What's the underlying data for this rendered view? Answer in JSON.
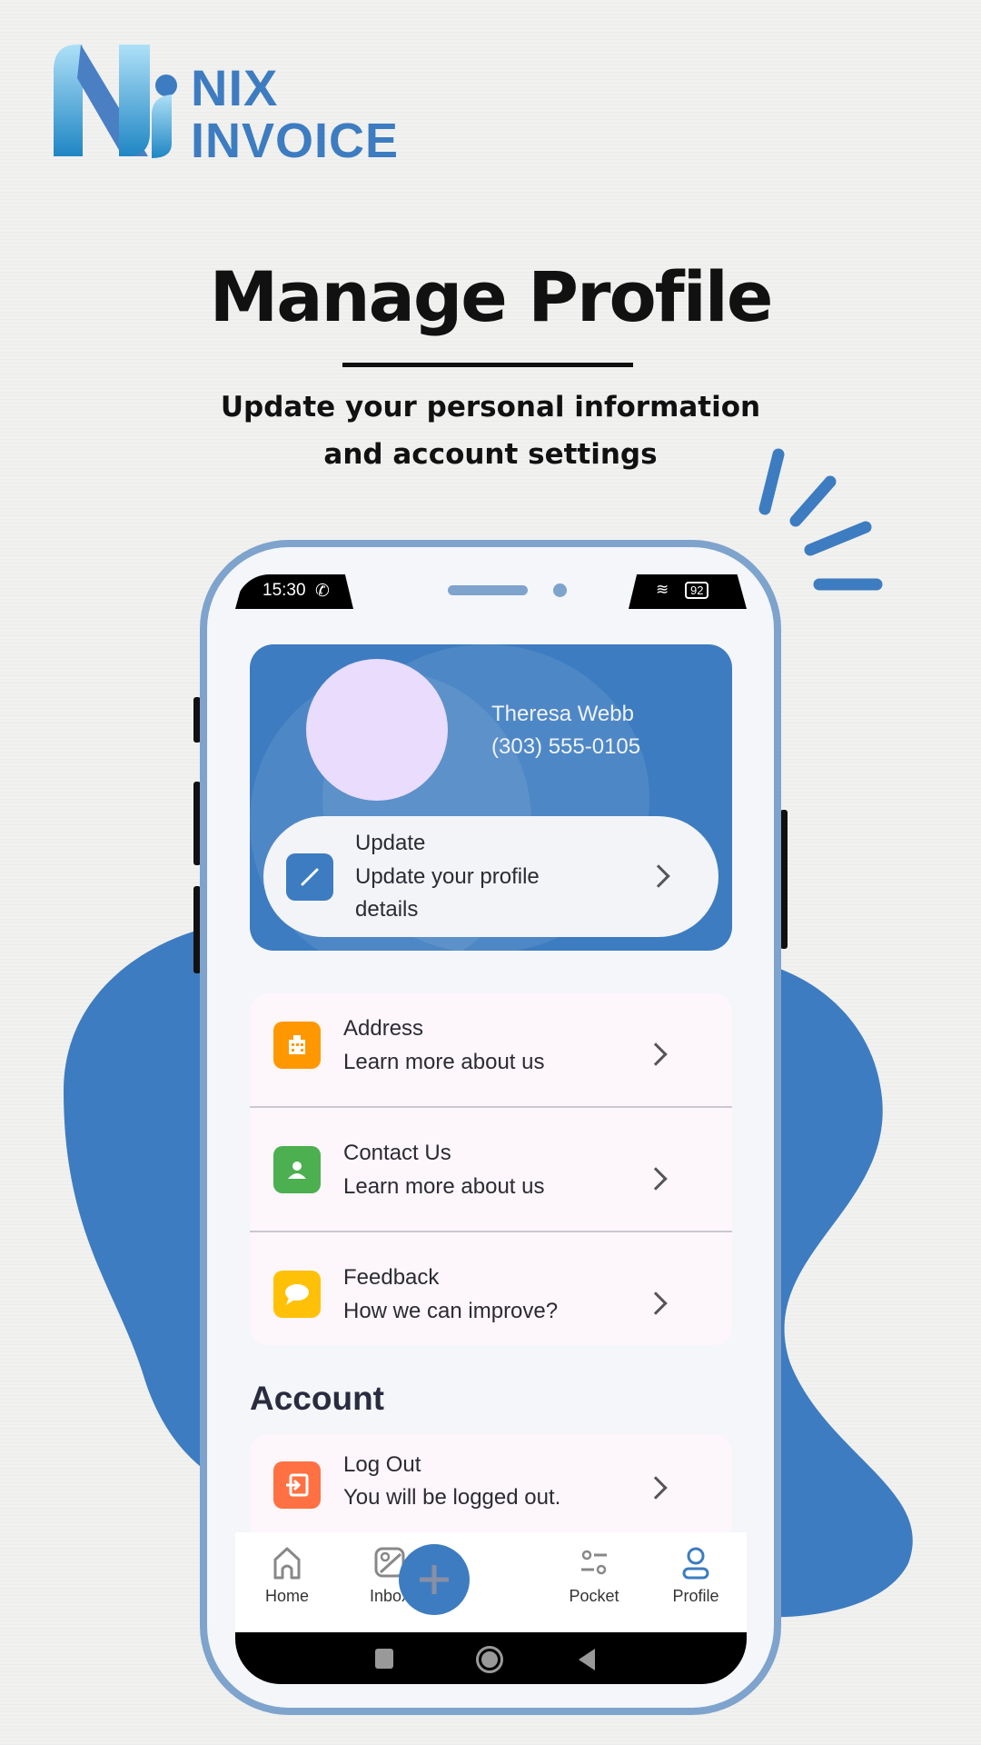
{
  "brand": {
    "line1": "NIX",
    "line2": "INVOICE",
    "color": "#3d7cc0"
  },
  "hero": {
    "title": "Manage Profile",
    "subtitle_line1": "Update your personal information",
    "subtitle_line2": "and account settings"
  },
  "status_bar": {
    "time": "15:30",
    "battery": "92"
  },
  "profile": {
    "name": "Theresa Webb",
    "phone": "(303) 555-0105",
    "update_title": "Update",
    "update_sub_line1": "Update your profile",
    "update_sub_line2": "details"
  },
  "menu": [
    {
      "title": "Address",
      "subtitle": "Learn more about us",
      "icon": "building-icon",
      "color": "#FF9800"
    },
    {
      "title": "Contact Us",
      "subtitle": "Learn more about us",
      "icon": "person-icon",
      "color": "#4CAF50"
    },
    {
      "title": "Feedback",
      "subtitle": "How we can improve?",
      "icon": "chat-icon",
      "color": "#FFC107"
    }
  ],
  "account": {
    "heading": "Account",
    "logout_title": "Log Out",
    "logout_sub": "You will be logged out.",
    "logout_color": "#FF7043"
  },
  "nav": {
    "home": "Home",
    "inbox": "Inbox",
    "pocket": "Pocket",
    "profile": "Profile",
    "active": "Profile"
  },
  "colors": {
    "accent": "#3d7cc0",
    "phone_frame": "#7ea3cc"
  }
}
